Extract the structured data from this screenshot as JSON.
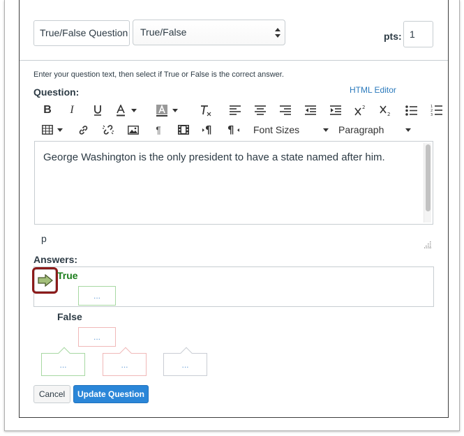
{
  "header": {
    "question_name": "True/False Question",
    "question_type": "True/False",
    "points_label": "pts:",
    "points_value": "1"
  },
  "form": {
    "instructions": "Enter your question text, then select if True or False is the correct answer.",
    "question_label": "Question:",
    "html_editor_link": "HTML Editor",
    "font_sizes_label": "Font Sizes",
    "paragraph_label": "Paragraph"
  },
  "toolbar_icons": [
    "bold-icon",
    "italic-icon",
    "underline-icon",
    "text-color-icon",
    "background-color-icon",
    "clear-formatting-icon",
    "align-left-icon",
    "align-center-icon",
    "align-right-icon",
    "outdent-icon",
    "indent-icon",
    "superscript-icon",
    "subscript-icon",
    "bullet-list-icon",
    "numbered-list-icon",
    "table-icon",
    "link-icon",
    "unlink-icon",
    "image-icon",
    "paragraph-mark-icon",
    "media-icon",
    "ltr-icon",
    "rtl-icon"
  ],
  "editor": {
    "content": "George Washington is the only president to have a state named after him.",
    "path": "p"
  },
  "answers": {
    "label": "Answers:",
    "true_label": "True",
    "false_label": "False",
    "comment_placeholder": "..."
  },
  "colors": {
    "correct_green": "#1a7d1a",
    "link_blue": "#2b7abc",
    "primary_button": "#2a86d8",
    "highlight_border": "#8b1a1a"
  },
  "buttons": {
    "cancel": "Cancel",
    "update": "Update Question"
  }
}
